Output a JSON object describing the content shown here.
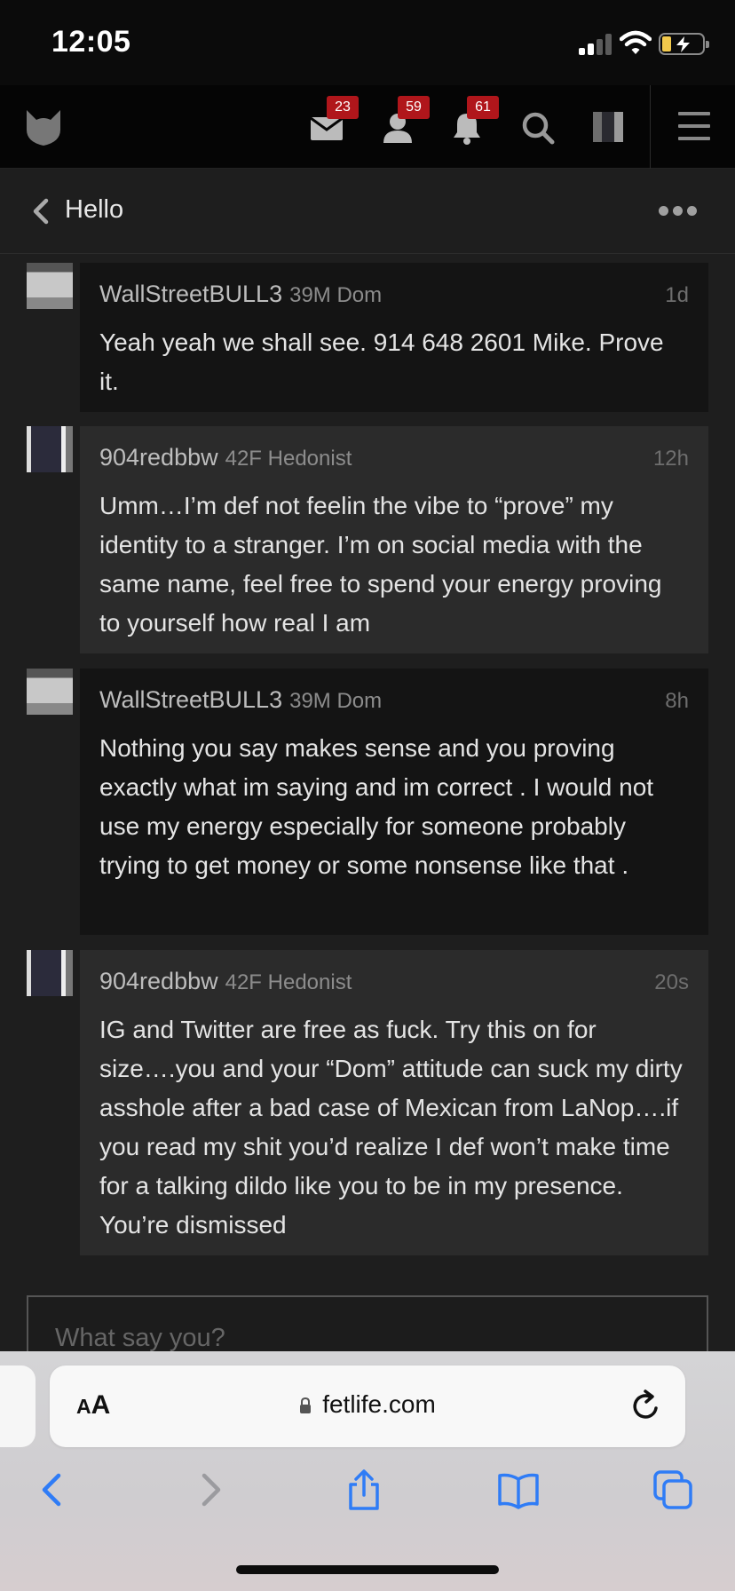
{
  "status_bar": {
    "time": "12:05",
    "battery_state": "charging"
  },
  "nav": {
    "logo": "fetlife-logo-icon",
    "messages_badge": "23",
    "friends_badge": "59",
    "notifications_badge": "61",
    "icons": [
      "envelope-icon",
      "user-icon",
      "bell-icon",
      "search-icon",
      "avatar",
      "hamburger-menu-icon"
    ]
  },
  "conversation": {
    "title": "Hello"
  },
  "messages": [
    {
      "user": "WallStreetBULL3",
      "meta": "39M Dom",
      "time": "1d",
      "body": "Yeah yeah we shall see. 914 648 2601 Mike. Prove it."
    },
    {
      "user": "904redbbw",
      "meta": "42F Hedonist",
      "time": "12h",
      "body": "Umm…I’m def not feelin the vibe to “prove” my identity to a stranger. I’m on social media with the same name, feel free to spend your energy proving to yourself how real I am"
    },
    {
      "user": "WallStreetBULL3",
      "meta": "39M Dom",
      "time": "8h",
      "body": "Nothing you say makes sense and you proving exactly what im saying and im correct . I would not use my energy especially for someone probably trying to get money or some nonsense like that ."
    },
    {
      "user": "904redbbw",
      "meta": "42F Hedonist",
      "time": "20s",
      "body": "IG and Twitter are free as fuck. Try this on for size….you and your “Dom” attitude can suck my dirty asshole after a bad case of Mexican from LaNop….if you read my shit you’d realize I def won’t make time for a talking dildo like you to be in my presence. You’re dismissed"
    }
  ],
  "composer": {
    "placeholder": "What say you?",
    "value": ""
  },
  "browser": {
    "aa_big": "A",
    "aa_small": "A",
    "url": "fetlife.com",
    "toolbar": [
      "back-icon",
      "forward-icon",
      "share-icon",
      "bookmarks-icon",
      "tabs-icon"
    ]
  },
  "colors": {
    "badge": "#b0161b",
    "safari_blue": "#2f7cf6",
    "app_bg": "#1e1e1e"
  }
}
